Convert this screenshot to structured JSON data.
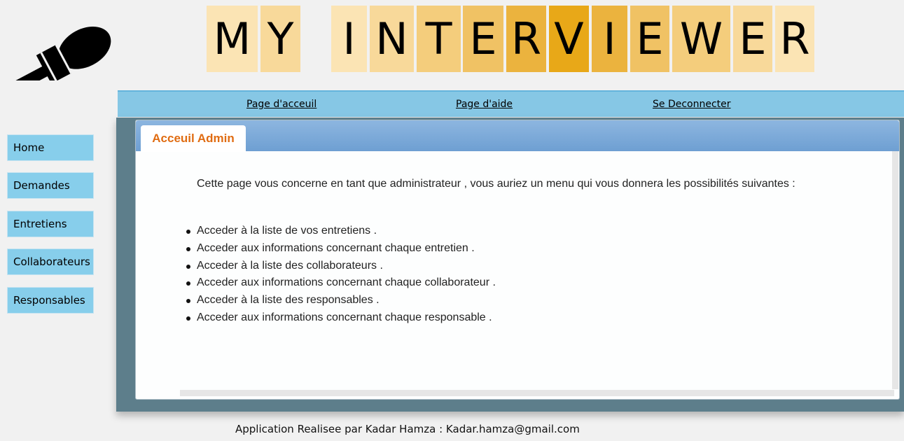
{
  "logo": {
    "icon": "microphone-icon",
    "letters": [
      "M",
      "Y",
      "",
      "I",
      "N",
      "T",
      "E",
      "R",
      "V",
      "I",
      "E",
      "W",
      "E",
      "R"
    ],
    "tile_colors": [
      "#fbe4b4",
      "#f8d99a",
      "",
      "#fbe4b4",
      "#f8d99a",
      "#f4cd7c",
      "#f0c264",
      "#ebb33e",
      "#e8a818",
      "#ebb33e",
      "#f0c264",
      "#f4cd7c",
      "#f8d99a",
      "#fbe4b4"
    ]
  },
  "nav": {
    "home": "Page d'acceuil",
    "help": "Page d'aide",
    "logout": "Se Deconnecter"
  },
  "sidebar": {
    "items": [
      {
        "label": "Home"
      },
      {
        "label": "Demandes"
      },
      {
        "label": "Entretiens"
      },
      {
        "label": "Collaborateurs"
      },
      {
        "label": "Responsables"
      }
    ]
  },
  "main": {
    "tab_label": "Acceuil Admin",
    "intro": "Cette page vous concerne en tant que administrateur , vous auriez un menu qui vous donnera les possibilités suivantes :",
    "bullets": [
      "Acceder à la liste de vos entretiens .",
      "Acceder aux informations concernant chaque entretien .",
      "Acceder à la liste des collaborateurs .",
      "Acceder aux informations concernant chaque collaborateur .",
      "Acceder à la liste des responsables .",
      "Acceder aux informations concernant chaque responsable ."
    ]
  },
  "footer": {
    "text": "Application Realisee par Kadar Hamza : Kadar.hamza@gmail.com"
  },
  "colors": {
    "nav_bar": "#86c7e5",
    "sidebar_button": "#87ceeb",
    "main_frame": "#5d7e8b",
    "tab_text": "#e06c12"
  }
}
